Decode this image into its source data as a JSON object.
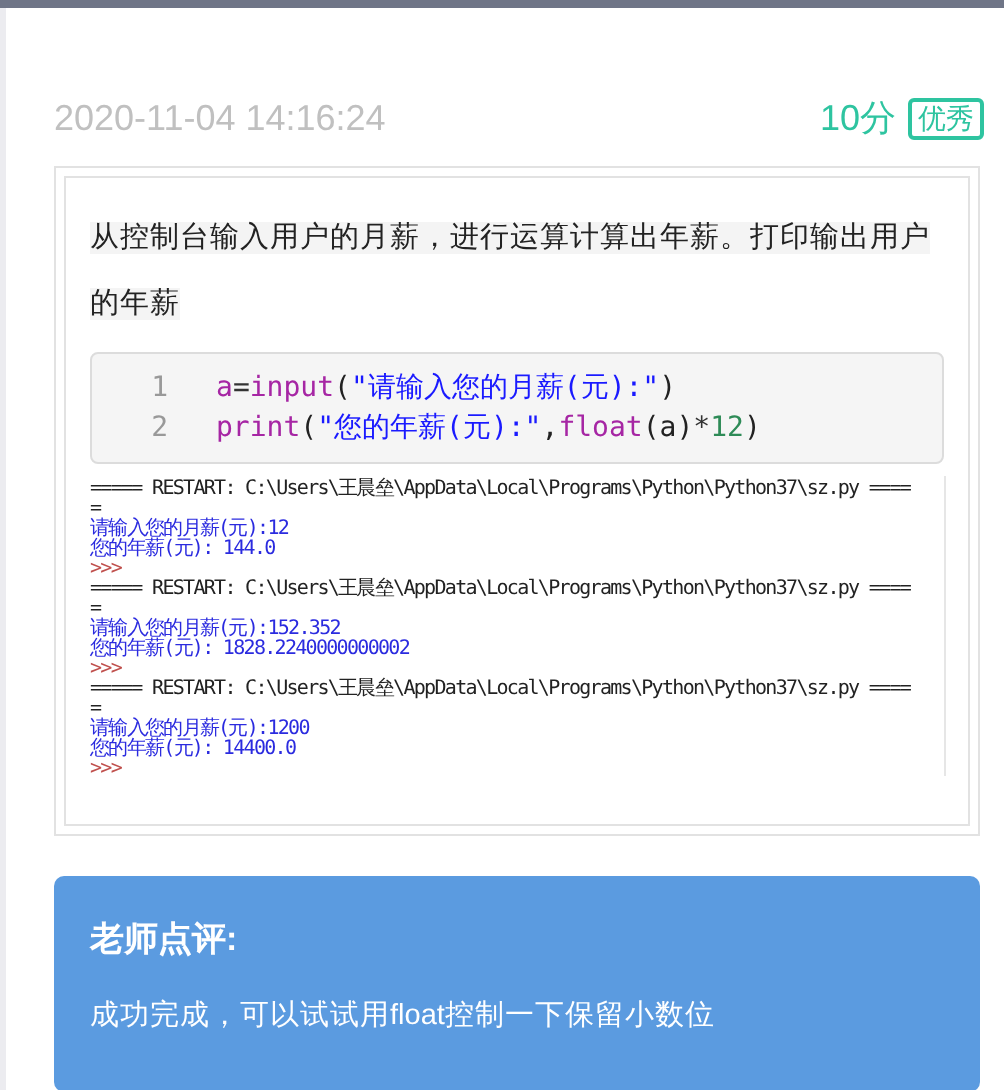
{
  "submission": {
    "time": "2020-11-04 14:16:24",
    "score": "10分",
    "grade": "优秀"
  },
  "question": "从控制台输入用户的月薪，进行运算计算出年薪。打印输出用户的年薪",
  "code": [
    {
      "number": "1",
      "tokens": [
        {
          "kind": "name",
          "text": "a"
        },
        {
          "kind": "op",
          "text": "="
        },
        {
          "kind": "builtin",
          "text": "input"
        },
        {
          "kind": "punct",
          "text": "("
        },
        {
          "kind": "string",
          "text": "\"请输入您的月薪(元):\""
        },
        {
          "kind": "punct",
          "text": ")"
        }
      ]
    },
    {
      "number": "2",
      "tokens": [
        {
          "kind": "builtin",
          "text": "print"
        },
        {
          "kind": "punct",
          "text": "("
        },
        {
          "kind": "string",
          "text": "\"您的年薪(元):\""
        },
        {
          "kind": "punct",
          "text": ","
        },
        {
          "kind": "builtin",
          "text": "float"
        },
        {
          "kind": "punct",
          "text": "(a)"
        },
        {
          "kind": "op",
          "text": "*"
        },
        {
          "kind": "number",
          "text": "12"
        },
        {
          "kind": "punct",
          "text": ")"
        }
      ]
    }
  ],
  "shell_output": [
    {
      "kind": "restart",
      "text": "===== RESTART: C:\\Users\\王晨垒\\AppData\\Local\\Programs\\Python\\Python37\\sz.py ===="
    },
    {
      "kind": "restart",
      "text": "="
    },
    {
      "kind": "output",
      "text": "请输入您的月薪(元):12"
    },
    {
      "kind": "output",
      "text": "您的年薪(元): 144.0"
    },
    {
      "kind": "prompt",
      "text": ">>>"
    },
    {
      "kind": "restart",
      "text": "===== RESTART: C:\\Users\\王晨垒\\AppData\\Local\\Programs\\Python\\Python37\\sz.py ===="
    },
    {
      "kind": "restart",
      "text": "="
    },
    {
      "kind": "output",
      "text": "请输入您的月薪(元):152.352"
    },
    {
      "kind": "output",
      "text": "您的年薪(元): 1828.2240000000002"
    },
    {
      "kind": "prompt",
      "text": ">>>"
    },
    {
      "kind": "restart",
      "text": "===== RESTART: C:\\Users\\王晨垒\\AppData\\Local\\Programs\\Python\\Python37\\sz.py ===="
    },
    {
      "kind": "restart",
      "text": "="
    },
    {
      "kind": "output",
      "text": "请输入您的月薪(元):1200"
    },
    {
      "kind": "output",
      "text": "您的年薪(元): 14400.0"
    },
    {
      "kind": "prompt",
      "text": ">>>"
    }
  ],
  "review": {
    "title": "老师点评:",
    "comment": "成功完成，可以试试用float控制一下保留小数位"
  }
}
